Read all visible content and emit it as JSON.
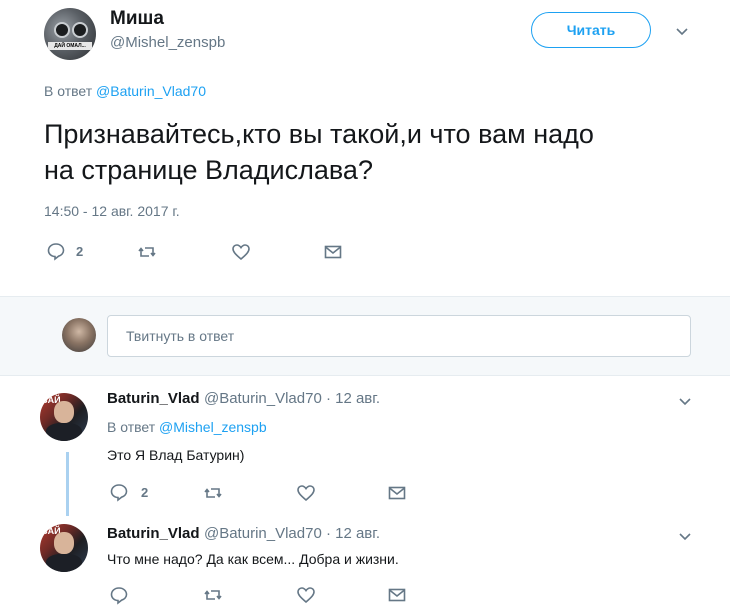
{
  "tweet": {
    "display_name": "Миша",
    "handle": "@Mishel_zenspb",
    "follow_label": "Читать",
    "avatar_caption": "ДАЙ ОМАЛ...",
    "reply_prefix": "В ответ",
    "reply_to": "@Baturin_Vlad70",
    "text_line1": "Признавайтесь,кто вы такой,и что вам надо",
    "text_line2": "на странице Владислава?",
    "timestamp": "14:50 - 12 авг. 2017 г.",
    "reply_count": "2"
  },
  "reply_box": {
    "placeholder": "Твитнуть в ответ"
  },
  "replies": [
    {
      "name": "Baturin_Vlad",
      "handle_date": "@Baturin_Vlad70 · 12 авг.",
      "reply_prefix": "В ответ",
      "reply_to": "@Mishel_zenspb",
      "text": "Это Я Влад  Батурин)",
      "reply_count": "2",
      "avatar_text": "ЗАЙ"
    },
    {
      "name": "Baturin_Vlad",
      "handle_date": "@Baturin_Vlad70 · 12 авг.",
      "text": "Что мне надо? Да как всем...  Добра и жизни.",
      "avatar_text": "ЗАЙ"
    }
  ],
  "colors": {
    "accent": "#1da1f2",
    "muted": "#657786",
    "thread_line": "#aad1f0"
  }
}
